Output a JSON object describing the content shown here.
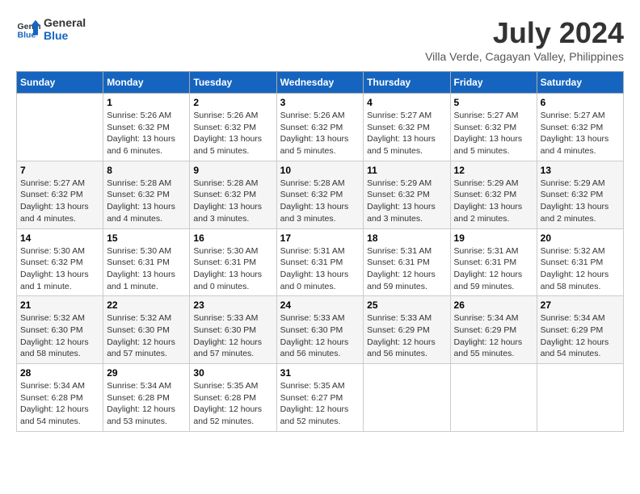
{
  "header": {
    "logo_general": "General",
    "logo_blue": "Blue",
    "main_title": "July 2024",
    "subtitle": "Villa Verde, Cagayan Valley, Philippines"
  },
  "calendar": {
    "days_of_week": [
      "Sunday",
      "Monday",
      "Tuesday",
      "Wednesday",
      "Thursday",
      "Friday",
      "Saturday"
    ],
    "weeks": [
      [
        {
          "day": "",
          "info": ""
        },
        {
          "day": "1",
          "info": "Sunrise: 5:26 AM\nSunset: 6:32 PM\nDaylight: 13 hours and 6 minutes."
        },
        {
          "day": "2",
          "info": "Sunrise: 5:26 AM\nSunset: 6:32 PM\nDaylight: 13 hours and 5 minutes."
        },
        {
          "day": "3",
          "info": "Sunrise: 5:26 AM\nSunset: 6:32 PM\nDaylight: 13 hours and 5 minutes."
        },
        {
          "day": "4",
          "info": "Sunrise: 5:27 AM\nSunset: 6:32 PM\nDaylight: 13 hours and 5 minutes."
        },
        {
          "day": "5",
          "info": "Sunrise: 5:27 AM\nSunset: 6:32 PM\nDaylight: 13 hours and 5 minutes."
        },
        {
          "day": "6",
          "info": "Sunrise: 5:27 AM\nSunset: 6:32 PM\nDaylight: 13 hours and 4 minutes."
        }
      ],
      [
        {
          "day": "7",
          "info": "Sunrise: 5:27 AM\nSunset: 6:32 PM\nDaylight: 13 hours and 4 minutes."
        },
        {
          "day": "8",
          "info": "Sunrise: 5:28 AM\nSunset: 6:32 PM\nDaylight: 13 hours and 4 minutes."
        },
        {
          "day": "9",
          "info": "Sunrise: 5:28 AM\nSunset: 6:32 PM\nDaylight: 13 hours and 3 minutes."
        },
        {
          "day": "10",
          "info": "Sunrise: 5:28 AM\nSunset: 6:32 PM\nDaylight: 13 hours and 3 minutes."
        },
        {
          "day": "11",
          "info": "Sunrise: 5:29 AM\nSunset: 6:32 PM\nDaylight: 13 hours and 3 minutes."
        },
        {
          "day": "12",
          "info": "Sunrise: 5:29 AM\nSunset: 6:32 PM\nDaylight: 13 hours and 2 minutes."
        },
        {
          "day": "13",
          "info": "Sunrise: 5:29 AM\nSunset: 6:32 PM\nDaylight: 13 hours and 2 minutes."
        }
      ],
      [
        {
          "day": "14",
          "info": "Sunrise: 5:30 AM\nSunset: 6:32 PM\nDaylight: 13 hours and 1 minute."
        },
        {
          "day": "15",
          "info": "Sunrise: 5:30 AM\nSunset: 6:31 PM\nDaylight: 13 hours and 1 minute."
        },
        {
          "day": "16",
          "info": "Sunrise: 5:30 AM\nSunset: 6:31 PM\nDaylight: 13 hours and 0 minutes."
        },
        {
          "day": "17",
          "info": "Sunrise: 5:31 AM\nSunset: 6:31 PM\nDaylight: 13 hours and 0 minutes."
        },
        {
          "day": "18",
          "info": "Sunrise: 5:31 AM\nSunset: 6:31 PM\nDaylight: 12 hours and 59 minutes."
        },
        {
          "day": "19",
          "info": "Sunrise: 5:31 AM\nSunset: 6:31 PM\nDaylight: 12 hours and 59 minutes."
        },
        {
          "day": "20",
          "info": "Sunrise: 5:32 AM\nSunset: 6:31 PM\nDaylight: 12 hours and 58 minutes."
        }
      ],
      [
        {
          "day": "21",
          "info": "Sunrise: 5:32 AM\nSunset: 6:30 PM\nDaylight: 12 hours and 58 minutes."
        },
        {
          "day": "22",
          "info": "Sunrise: 5:32 AM\nSunset: 6:30 PM\nDaylight: 12 hours and 57 minutes."
        },
        {
          "day": "23",
          "info": "Sunrise: 5:33 AM\nSunset: 6:30 PM\nDaylight: 12 hours and 57 minutes."
        },
        {
          "day": "24",
          "info": "Sunrise: 5:33 AM\nSunset: 6:30 PM\nDaylight: 12 hours and 56 minutes."
        },
        {
          "day": "25",
          "info": "Sunrise: 5:33 AM\nSunset: 6:29 PM\nDaylight: 12 hours and 56 minutes."
        },
        {
          "day": "26",
          "info": "Sunrise: 5:34 AM\nSunset: 6:29 PM\nDaylight: 12 hours and 55 minutes."
        },
        {
          "day": "27",
          "info": "Sunrise: 5:34 AM\nSunset: 6:29 PM\nDaylight: 12 hours and 54 minutes."
        }
      ],
      [
        {
          "day": "28",
          "info": "Sunrise: 5:34 AM\nSunset: 6:28 PM\nDaylight: 12 hours and 54 minutes."
        },
        {
          "day": "29",
          "info": "Sunrise: 5:34 AM\nSunset: 6:28 PM\nDaylight: 12 hours and 53 minutes."
        },
        {
          "day": "30",
          "info": "Sunrise: 5:35 AM\nSunset: 6:28 PM\nDaylight: 12 hours and 52 minutes."
        },
        {
          "day": "31",
          "info": "Sunrise: 5:35 AM\nSunset: 6:27 PM\nDaylight: 12 hours and 52 minutes."
        },
        {
          "day": "",
          "info": ""
        },
        {
          "day": "",
          "info": ""
        },
        {
          "day": "",
          "info": ""
        }
      ]
    ]
  }
}
